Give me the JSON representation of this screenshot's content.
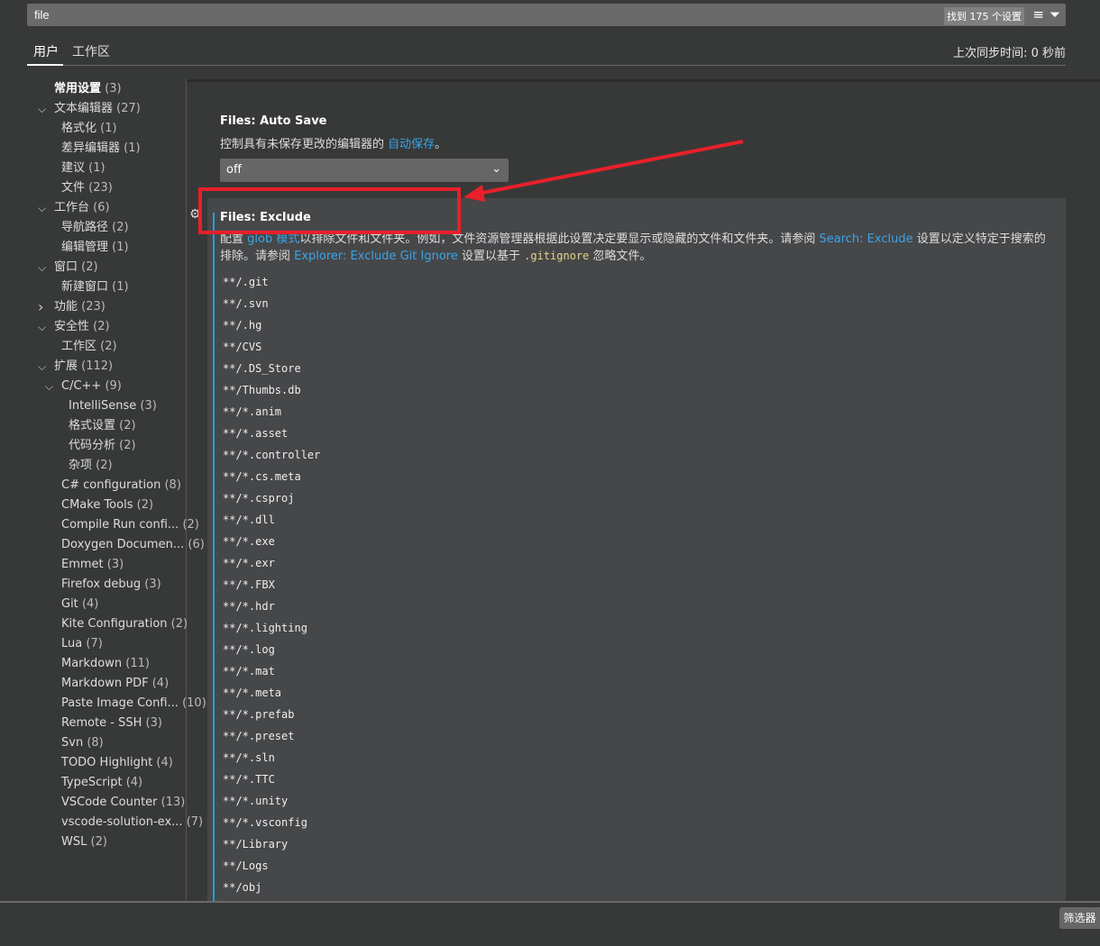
{
  "search": {
    "value": "file",
    "result_count": "找到 175 个设置",
    "icons": [
      "clear-filter-list-icon",
      "filter-icon"
    ]
  },
  "tabs": [
    {
      "label": "用户",
      "active": true
    },
    {
      "label": "工作区",
      "active": false
    }
  ],
  "sync_status": "上次同步时间: 0 秒前",
  "sidebar": [
    {
      "label": "常用设置",
      "count": "(3)",
      "level": 0,
      "chevron": "",
      "bold": true
    },
    {
      "label": "文本编辑器",
      "count": "(27)",
      "level": 0,
      "chevron": "down"
    },
    {
      "label": "格式化",
      "count": "(1)",
      "level": 1,
      "chevron": ""
    },
    {
      "label": "差异编辑器",
      "count": "(1)",
      "level": 1,
      "chevron": ""
    },
    {
      "label": "建议",
      "count": "(1)",
      "level": 1,
      "chevron": ""
    },
    {
      "label": "文件",
      "count": "(23)",
      "level": 1,
      "chevron": ""
    },
    {
      "label": "工作台",
      "count": "(6)",
      "level": 0,
      "chevron": "down"
    },
    {
      "label": "导航路径",
      "count": "(2)",
      "level": 1,
      "chevron": ""
    },
    {
      "label": "编辑管理",
      "count": "(1)",
      "level": 1,
      "chevron": ""
    },
    {
      "label": "窗口",
      "count": "(2)",
      "level": 0,
      "chevron": "down"
    },
    {
      "label": "新建窗口",
      "count": "(1)",
      "level": 1,
      "chevron": ""
    },
    {
      "label": "功能",
      "count": "(23)",
      "level": 0,
      "chevron": "right"
    },
    {
      "label": "安全性",
      "count": "(2)",
      "level": 0,
      "chevron": "down"
    },
    {
      "label": "工作区",
      "count": "(2)",
      "level": 1,
      "chevron": ""
    },
    {
      "label": "扩展",
      "count": "(112)",
      "level": 0,
      "chevron": "down"
    },
    {
      "label": "C/C++",
      "count": "(9)",
      "level": 1,
      "chevron": "down"
    },
    {
      "label": "IntelliSense",
      "count": "(3)",
      "level": 2,
      "chevron": ""
    },
    {
      "label": "格式设置",
      "count": "(2)",
      "level": 2,
      "chevron": ""
    },
    {
      "label": "代码分析",
      "count": "(2)",
      "level": 2,
      "chevron": ""
    },
    {
      "label": "杂项",
      "count": "(2)",
      "level": 2,
      "chevron": ""
    },
    {
      "label": "C# configuration",
      "count": "(8)",
      "level": 1,
      "chevron": ""
    },
    {
      "label": "CMake Tools",
      "count": "(2)",
      "level": 1,
      "chevron": ""
    },
    {
      "label": "Compile Run confi...",
      "count": "(2)",
      "level": 1,
      "chevron": ""
    },
    {
      "label": "Doxygen Documen...",
      "count": "(6)",
      "level": 1,
      "chevron": ""
    },
    {
      "label": "Emmet",
      "count": "(3)",
      "level": 1,
      "chevron": ""
    },
    {
      "label": "Firefox debug",
      "count": "(3)",
      "level": 1,
      "chevron": ""
    },
    {
      "label": "Git",
      "count": "(4)",
      "level": 1,
      "chevron": ""
    },
    {
      "label": "Kite Configuration",
      "count": "(2)",
      "level": 1,
      "chevron": ""
    },
    {
      "label": "Lua",
      "count": "(7)",
      "level": 1,
      "chevron": ""
    },
    {
      "label": "Markdown",
      "count": "(11)",
      "level": 1,
      "chevron": ""
    },
    {
      "label": "Markdown PDF",
      "count": "(4)",
      "level": 1,
      "chevron": ""
    },
    {
      "label": "Paste Image Confi...",
      "count": "(10)",
      "level": 1,
      "chevron": ""
    },
    {
      "label": "Remote - SSH",
      "count": "(3)",
      "level": 1,
      "chevron": ""
    },
    {
      "label": "Svn",
      "count": "(8)",
      "level": 1,
      "chevron": ""
    },
    {
      "label": "TODO Highlight",
      "count": "(4)",
      "level": 1,
      "chevron": ""
    },
    {
      "label": "TypeScript",
      "count": "(4)",
      "level": 1,
      "chevron": ""
    },
    {
      "label": "VSCode Counter",
      "count": "(13)",
      "level": 1,
      "chevron": ""
    },
    {
      "label": "vscode-solution-ex...",
      "count": "(7)",
      "level": 1,
      "chevron": ""
    },
    {
      "label": "WSL",
      "count": "(2)",
      "level": 1,
      "chevron": ""
    }
  ],
  "auto_save": {
    "title": "Files: Auto Save",
    "desc_prefix": "控制具有未保存更改的编辑器的 ",
    "desc_link": "自动保存",
    "desc_suffix": "。",
    "value": "off"
  },
  "exclude": {
    "title": "Files: Exclude",
    "desc": [
      "配置 ",
      "glob 模式",
      "以排除文件和文件夹。例如，文件资源管理器根据此设置决定要显示或隐藏的文件和文件夹。请参阅 ",
      "Search: Exclude",
      " 设置以定义特定于搜索的排除。请参阅 ",
      "Explorer: Exclude Git Ignore",
      " 设置以基于 ",
      ".gitignore",
      " 忽略文件。"
    ],
    "patterns": [
      "**/.git",
      "**/.svn",
      "**/.hg",
      "**/CVS",
      "**/.DS_Store",
      "**/Thumbs.db",
      "**/*.anim",
      "**/*.asset",
      "**/*.controller",
      "**/*.cs.meta",
      "**/*.csproj",
      "**/*.dll",
      "**/*.exe",
      "**/*.exr",
      "**/*.FBX",
      "**/*.hdr",
      "**/*.lighting",
      "**/*.log",
      "**/*.mat",
      "**/*.meta",
      "**/*.prefab",
      "**/*.preset",
      "**/*.sln",
      "**/*.TTC",
      "**/*.unity",
      "**/*.vsconfig",
      "**/Library",
      "**/Logs",
      "**/obj"
    ]
  },
  "filter_button": "筛选器",
  "annotation_color": "#e8202a",
  "accent": "#1ea0e0"
}
